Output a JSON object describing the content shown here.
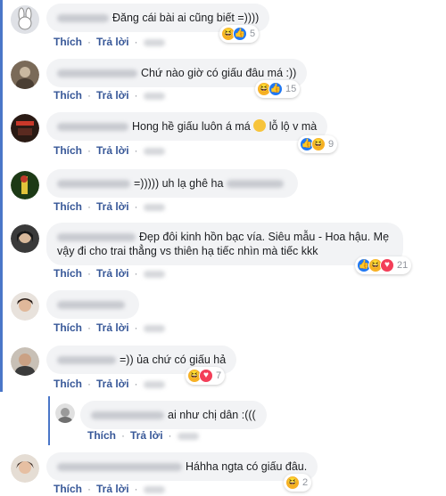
{
  "actions": {
    "like": "Thích",
    "reply": "Trả lời",
    "separator": "·"
  },
  "colors": {
    "link": "#385898",
    "bubble": "#f2f3f5",
    "thread_line": "#4a76c8",
    "like": "#2078f4",
    "haha": "#f7b125",
    "love": "#f33e58"
  },
  "comments": [
    {
      "text": "Đăng cái bài ai cũng biết =))))",
      "reactions": [
        "haha",
        "like"
      ],
      "count": "5"
    },
    {
      "text": "Chứ nào giờ có giấu đâu má :))",
      "reactions": [
        "haha",
        "like"
      ],
      "count": "15"
    },
    {
      "text_before": "Hong hề giấu luôn á má",
      "emoji": "smile-emoji",
      "text_after": "lỗ lộ v mà",
      "reactions": [
        "like",
        "haha"
      ],
      "count": "9"
    },
    {
      "text": "=))))) uh lạ ghê ha"
    },
    {
      "text": "Đẹp đôi kinh hồn bạc vía. Siêu mẫu - Hoa hậu. Mẹ vậy đi cho trai thẳng vs thiên hạ tiếc nhìn mà tiếc kkk",
      "reactions": [
        "like",
        "haha",
        "love"
      ],
      "count": "21"
    },
    {
      "text": ""
    },
    {
      "text": "=)) ủa chứ có giấu hả",
      "reactions": [
        "haha",
        "love"
      ],
      "count": "7"
    },
    {
      "text": "ai như chị dân :((("
    },
    {
      "text": "Háhha ngta có giấu đâu.",
      "reactions": [
        "haha"
      ],
      "count": "2"
    }
  ]
}
